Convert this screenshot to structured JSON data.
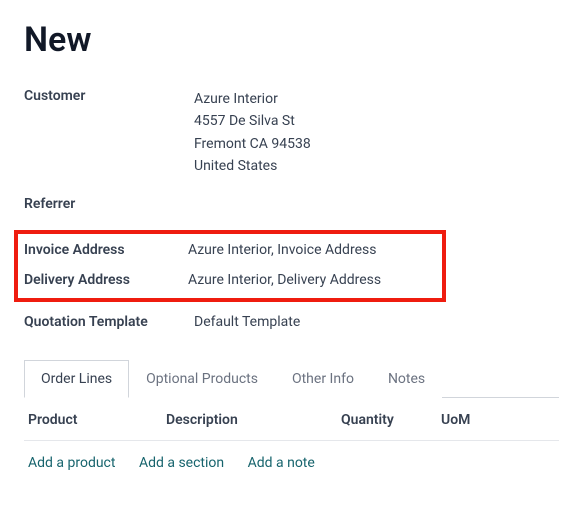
{
  "title": "New",
  "fields": {
    "customer_label": "Customer",
    "customer_name": "Azure Interior",
    "customer_addr1": "4557 De Silva St",
    "customer_addr2": "Fremont CA 94538",
    "customer_addr3": "United States",
    "referrer_label": "Referrer",
    "referrer_value": "",
    "invoice_addr_label": "Invoice Address",
    "invoice_addr_value": "Azure Interior, Invoice Address",
    "delivery_addr_label": "Delivery Address",
    "delivery_addr_value": "Azure Interior, Delivery Address",
    "quotation_tmpl_label": "Quotation Template",
    "quotation_tmpl_value": "Default Template"
  },
  "tabs": {
    "order_lines": "Order Lines",
    "optional_products": "Optional Products",
    "other_info": "Other Info",
    "notes": "Notes"
  },
  "columns": {
    "product": "Product",
    "description": "Description",
    "quantity": "Quantity",
    "uom": "UoM"
  },
  "actions": {
    "add_product": "Add a product",
    "add_section": "Add a section",
    "add_note": "Add a note"
  }
}
